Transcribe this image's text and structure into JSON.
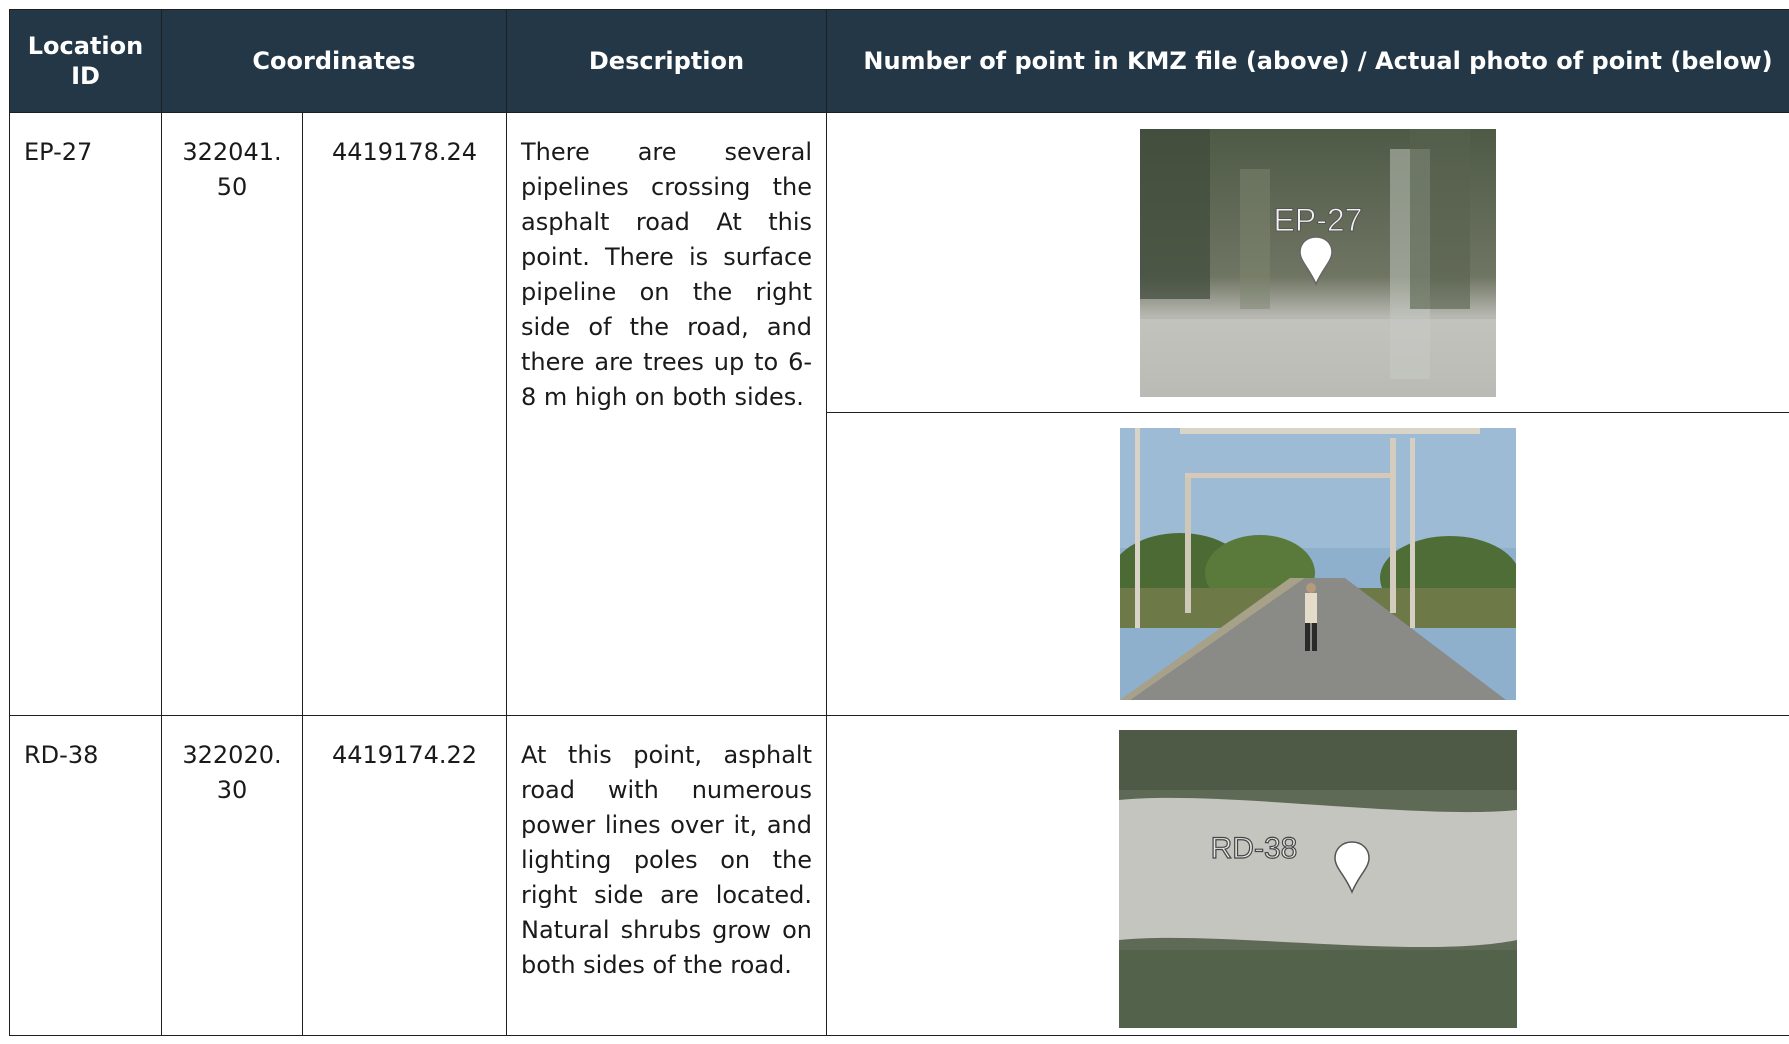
{
  "table": {
    "headers": {
      "location_id": "Location ID",
      "coordinates": "Coordinates",
      "description": "Description",
      "photo": "Number of point in KMZ file (above) / Actual photo of point (below)"
    },
    "rows": [
      {
        "id": "EP-27",
        "x": "322041.50",
        "y": "4419178.24",
        "description": "There are several pipelines crossing the asphalt road At this point. There is surface pipeline on the right side of the road, and there are trees up to 6-8 m high on both sides.",
        "kmz_label": "EP-27"
      },
      {
        "id": "RD-38",
        "x": "322020.30",
        "y": "4419174.22",
        "description": "At this point, asphalt road with numerous power lines over it, and lighting poles on the right side are located. Natural shrubs grow on both sides of the road.",
        "kmz_label": "RD-38"
      }
    ]
  },
  "colors": {
    "header_bg": "#233746",
    "header_text": "#ffffff",
    "border": "#1f1f1f"
  }
}
